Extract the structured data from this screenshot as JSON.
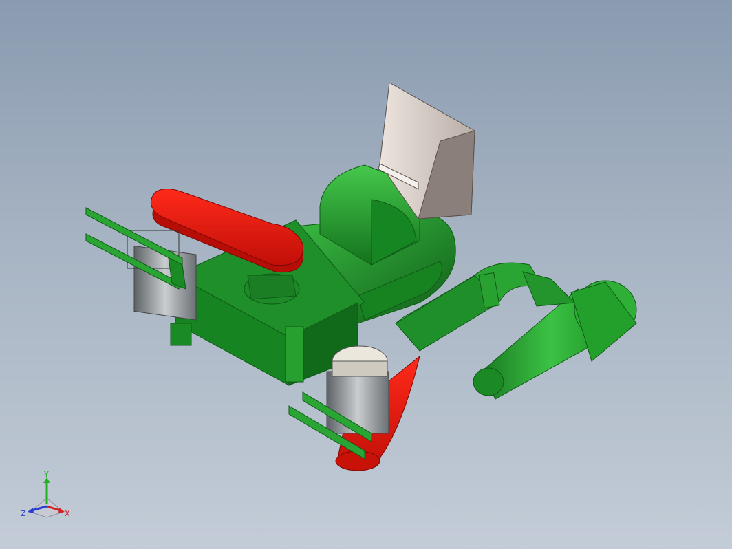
{
  "viewport": {
    "background_top": "#8a9bb0",
    "background_bottom": "#c3ccd7"
  },
  "model": {
    "colors": {
      "body_green": "#1f8f2a",
      "body_green_light": "#3cbf45",
      "body_green_dark": "#0f5c16",
      "belt_cover_red": "#e8170f",
      "belt_cover_red_dark": "#a30c07",
      "hopper_light": "#e6ddd6",
      "hopper_dark": "#8a7f7a",
      "motor_cap": "#ece7dc",
      "motor_gray": "#7d8286"
    }
  },
  "triad": {
    "x_label": "X",
    "y_label": "Y",
    "z_label": "Z",
    "x_color": "#d42020",
    "y_color": "#22b022",
    "z_color": "#2a3fd0"
  }
}
